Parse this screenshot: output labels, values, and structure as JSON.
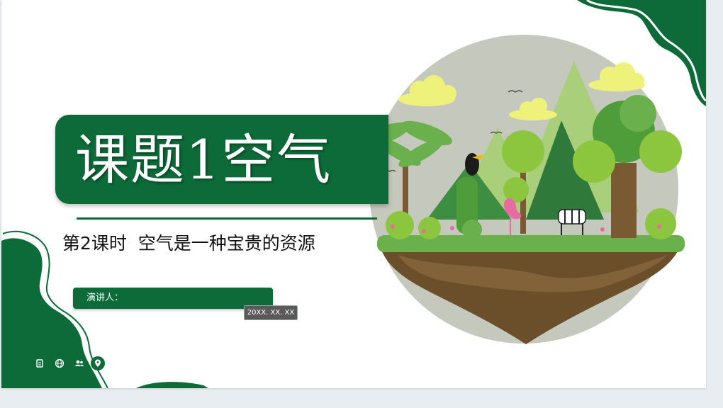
{
  "slide": {
    "title": "课题1空气",
    "subtitle": "第2课时  空气是一种宝贵的资源",
    "speaker_label": "演讲人：",
    "date": "20XX. XX. XX"
  },
  "colors": {
    "brand_green": "#0d6b39",
    "light_green": "#8cc63f",
    "circle_gray": "#c5c8bd"
  },
  "icons": [
    "clipboard-icon",
    "globe-icon",
    "users-icon",
    "location-pin-icon"
  ]
}
